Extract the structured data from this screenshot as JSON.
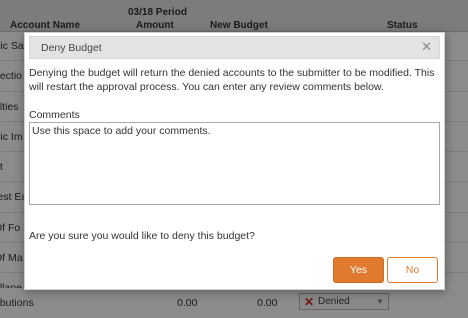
{
  "table": {
    "period_header": "03/18 Period",
    "columns": {
      "account_name": "Account Name",
      "amount": "Amount",
      "new_budget": "New Budget",
      "status": "Status"
    },
    "rows": [
      {
        "account": "tric Sa"
      },
      {
        "account": "nectio"
      },
      {
        "account": "alties"
      },
      {
        "account": "tric Im"
      },
      {
        "account": "nt"
      },
      {
        "account": "rest Ea"
      },
      {
        "account": "Of Fo"
      },
      {
        "account": "Of Ma"
      },
      {
        "account": "ellane"
      }
    ],
    "last_row": {
      "account": "ributions",
      "amount": "0.00",
      "new_budget": "0.00",
      "status": "Denied"
    }
  },
  "dialog": {
    "title": "Deny Budget",
    "close_glyph": "✕",
    "message": "Denying the budget will return the denied accounts to the submitter to be modified. This will restart the approval process. You can enter any review comments below.",
    "comments_label": "Comments",
    "comments_placeholder": "Use this space to add your comments.",
    "confirm_question": "Are you sure you would like to deny this budget?",
    "yes_label": "Yes",
    "no_label": "No"
  },
  "colors": {
    "accent": "#e07a2f",
    "denied_icon": "#d92b2b"
  },
  "icons": {
    "close": "close-icon",
    "denied": "x-icon",
    "dropdown": "chevron-down-icon"
  }
}
